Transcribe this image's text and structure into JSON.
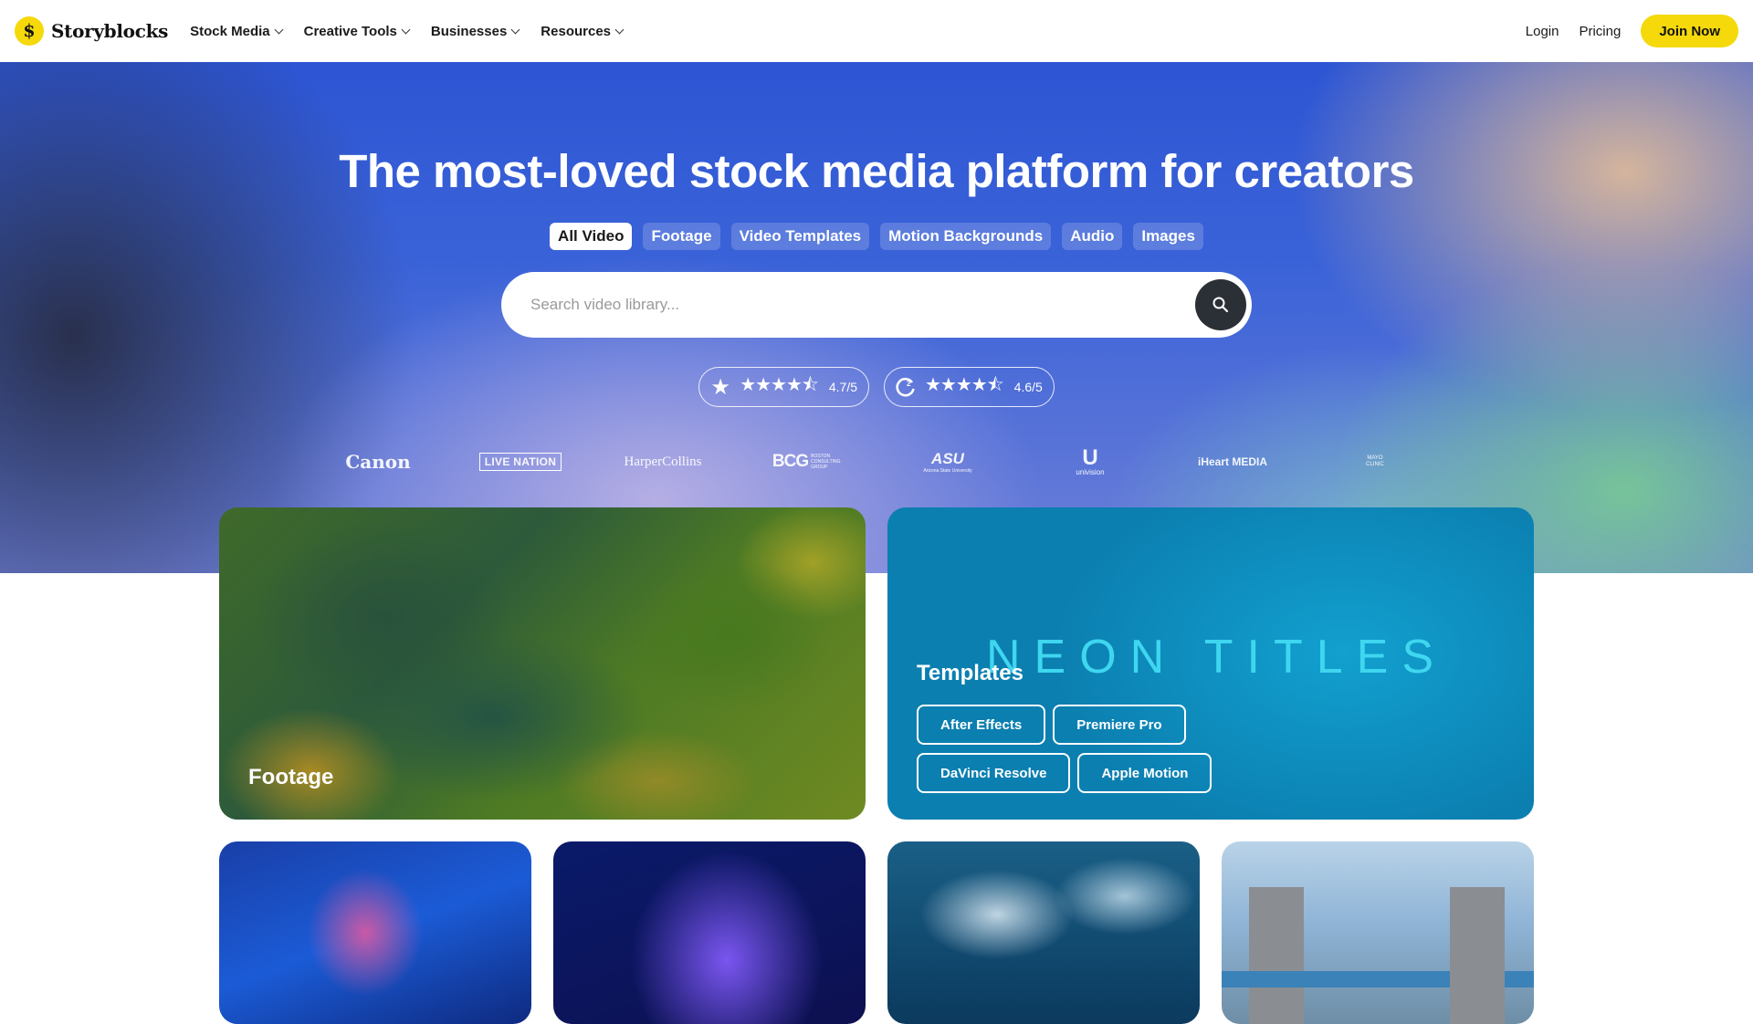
{
  "nav": {
    "brand": "Storyblocks",
    "brand_mark": "$",
    "links": [
      "Stock Media",
      "Creative Tools",
      "Businesses",
      "Resources"
    ],
    "login": "Login",
    "pricing": "Pricing",
    "join": "Join Now"
  },
  "hero": {
    "title": "The most-loved stock media platform for creators",
    "tabs": [
      "All Video",
      "Footage",
      "Video Templates",
      "Motion Backgrounds",
      "Audio",
      "Images"
    ],
    "active_tab": "All Video",
    "search_placeholder": "Search video library...",
    "ratings": [
      {
        "icon": "star-icon",
        "stars": "★★★★⯪",
        "value": "4.7/5"
      },
      {
        "icon": "g2-icon",
        "stars": "★★★★⯪",
        "value": "4.6/5"
      }
    ],
    "brands": {
      "canon": "Canon",
      "livenation": "LIVE NATION",
      "harper": "HarperCollins",
      "bcg": "BCG",
      "bcg_sub": "BOSTON CONSULTING GROUP",
      "asu": "ASU",
      "asu_sub": "Arizona State University",
      "univision": "univision",
      "iheart": "iHeart MEDIA",
      "mayo": "MAYO CLINIC"
    }
  },
  "cards": {
    "footage_label": "Footage",
    "templates_label": "Templates",
    "neon_text": "NEON TITLES",
    "template_buttons": [
      "After Effects",
      "Premiere Pro",
      "DaVinci Resolve",
      "Apple Motion"
    ]
  },
  "colors": {
    "accent": "#f5d90a",
    "search_button": "#2b2f36"
  }
}
